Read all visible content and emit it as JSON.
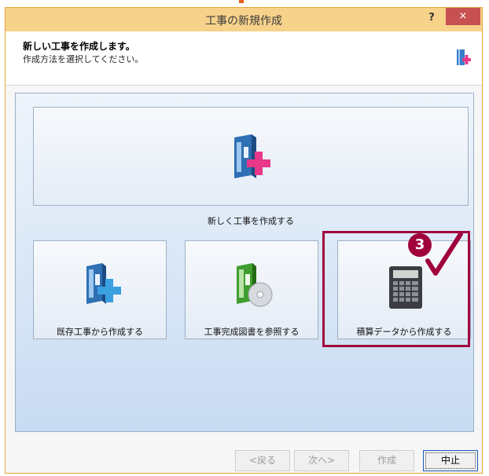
{
  "window": {
    "title": "工事の新規作成",
    "help_label": "?",
    "close_label": "×"
  },
  "header": {
    "title": "新しい工事を作成します。",
    "subtitle": "作成方法を選択してください。"
  },
  "options": [
    {
      "label": "新しく工事を作成する"
    },
    {
      "label": "既存工事から作成する"
    },
    {
      "label": "工事完成図書を参照する"
    },
    {
      "label": "積算データから作成する"
    }
  ],
  "annotation": {
    "step": "3"
  },
  "buttons": {
    "back": "<戻る",
    "next": "次へ>",
    "create": "作成",
    "cancel": "中止"
  },
  "colors": {
    "titlebar": "#f7d28a",
    "close": "#c75050",
    "highlight": "#a0003c",
    "book_blue": "#3a7ec9",
    "book_green": "#3f9e2f",
    "plus_pink": "#e8388a",
    "plus_blue": "#3aa0e0"
  }
}
